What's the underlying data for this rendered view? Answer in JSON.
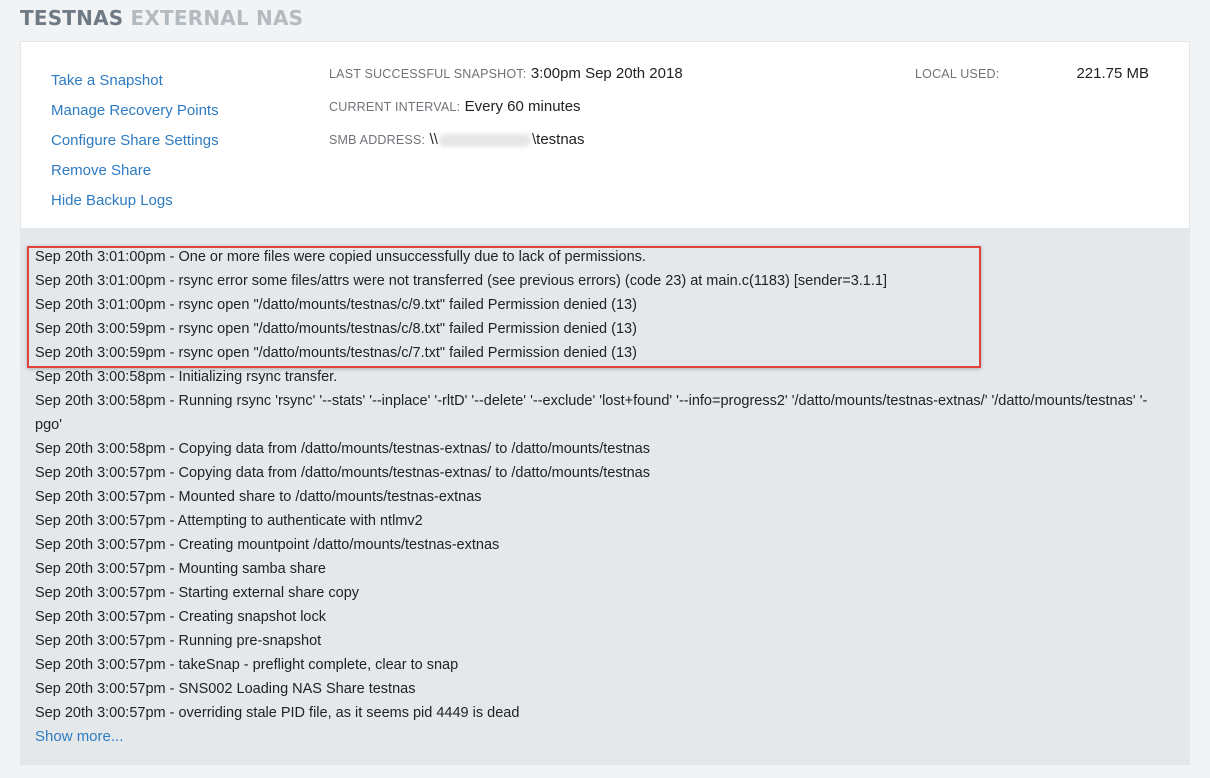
{
  "header": {
    "share_name": "TESTNAS",
    "share_type": "EXTERNAL NAS"
  },
  "actions": [
    "Take a Snapshot",
    "Manage Recovery Points",
    "Configure Share Settings",
    "Remove Share",
    "Hide Backup Logs"
  ],
  "info": {
    "last_snapshot_label": "LAST SUCCESSFUL SNAPSHOT:",
    "last_snapshot_value": "3:00pm Sep 20th 2018",
    "interval_label": "CURRENT INTERVAL:",
    "interval_value": "Every 60 minutes",
    "smb_label": "SMB ADDRESS:",
    "smb_prefix": "\\\\",
    "smb_suffix": "\\testnas",
    "local_used_label": "LOCAL USED:",
    "local_used_value": "221.75 MB"
  },
  "logs": [
    "Sep 20th 3:01:00pm - One or more files were copied unsuccessfully due to lack of permissions.",
    "Sep 20th 3:01:00pm - rsync error some files/attrs were not transferred (see previous errors) (code 23) at main.c(1183) [sender=3.1.1]",
    "Sep 20th 3:01:00pm - rsync open \"/datto/mounts/testnas/c/9.txt\" failed Permission denied (13)",
    "Sep 20th 3:00:59pm - rsync open \"/datto/mounts/testnas/c/8.txt\" failed Permission denied (13)",
    "Sep 20th 3:00:59pm - rsync open \"/datto/mounts/testnas/c/7.txt\" failed Permission denied (13)",
    "Sep 20th 3:00:58pm - Initializing rsync transfer.",
    "Sep 20th 3:00:58pm - Running rsync 'rsync' '--stats' '--inplace' '-rltD' '--delete' '--exclude' 'lost+found' '--info=progress2' '/datto/mounts/testnas-extnas/' '/datto/mounts/testnas' '-pgo'",
    "Sep 20th 3:00:58pm - Copying data from /datto/mounts/testnas-extnas/ to /datto/mounts/testnas",
    "Sep 20th 3:00:57pm - Copying data from /datto/mounts/testnas-extnas/ to /datto/mounts/testnas",
    "Sep 20th 3:00:57pm - Mounted share to /datto/mounts/testnas-extnas",
    "Sep 20th 3:00:57pm - Attempting to authenticate with ntlmv2",
    "Sep 20th 3:00:57pm - Creating mountpoint /datto/mounts/testnas-extnas",
    "Sep 20th 3:00:57pm - Mounting samba share",
    "Sep 20th 3:00:57pm - Starting external share copy",
    "Sep 20th 3:00:57pm - Creating snapshot lock",
    "Sep 20th 3:00:57pm - Running pre-snapshot",
    "Sep 20th 3:00:57pm - takeSnap - preflight complete, clear to snap",
    "Sep 20th 3:00:57pm - SNS002 Loading NAS Share testnas",
    "Sep 20th 3:00:57pm - overriding stale PID file, as it seems pid 4449 is dead"
  ],
  "show_more_label": "Show more..."
}
